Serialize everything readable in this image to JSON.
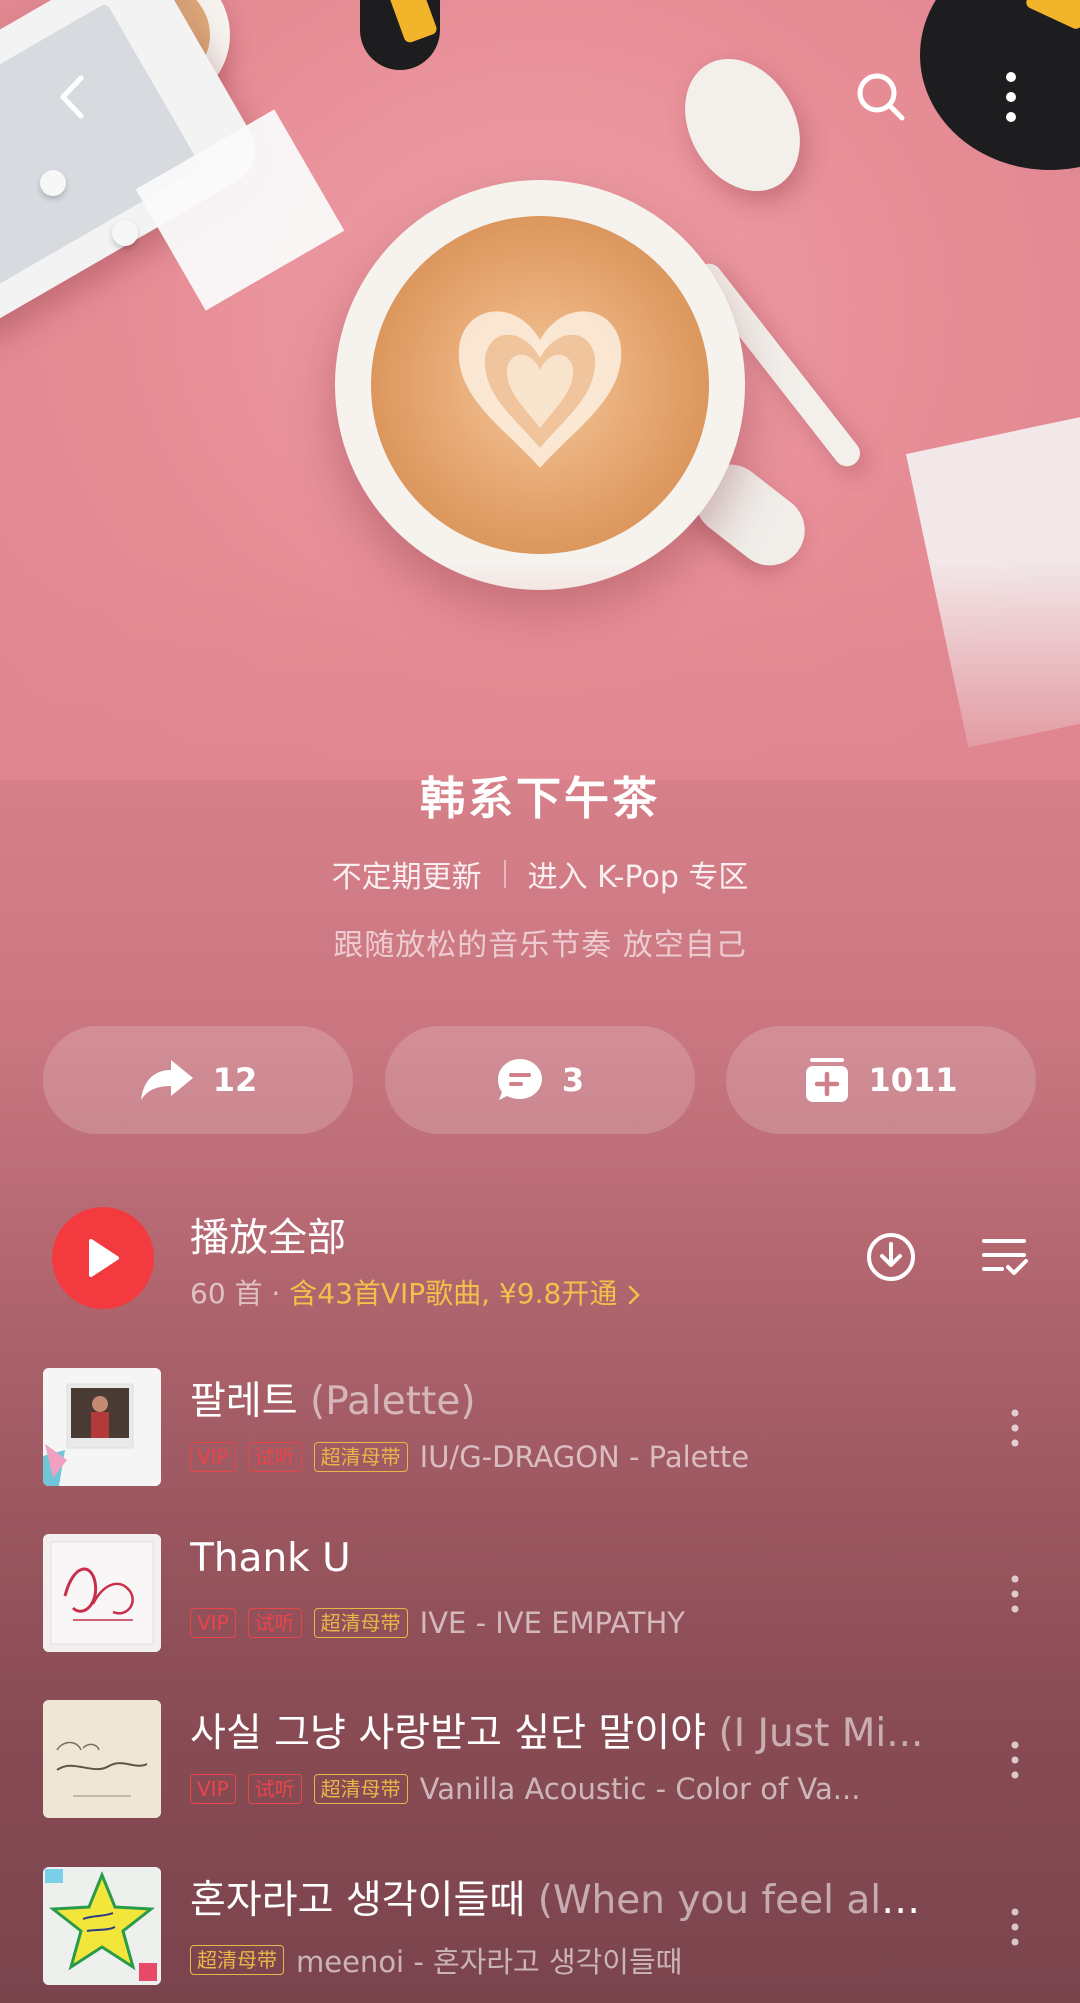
{
  "header": {
    "back_icon": "chevron-left-icon",
    "search_icon": "search-icon",
    "more_icon": "more-vertical-icon"
  },
  "playlist": {
    "title": "韩系下午茶",
    "update_text": "不定期更新",
    "zone_link": "进入 K-Pop 专区",
    "description": "跟随放松的音乐节奏 放空自己"
  },
  "actions": {
    "share": {
      "icon": "share-icon",
      "count": "12"
    },
    "comment": {
      "icon": "comment-icon",
      "count": "3"
    },
    "collect": {
      "icon": "add-to-collection-icon",
      "count": "1011"
    }
  },
  "play_all": {
    "label": "播放全部",
    "count_text": "60 首 ·",
    "vip_text": "含43首VIP歌曲, ¥9.8开通",
    "download_icon": "download-icon",
    "multi_select_icon": "list-check-icon"
  },
  "colors": {
    "play_button": "#f23a3f",
    "vip_gold": "#f3c04b",
    "tag_red": "#e8454a",
    "tag_gold": "#eab54a"
  },
  "songs": [
    {
      "title": "팔레트",
      "title_paren": "(Palette)",
      "tags": [
        "VIP",
        "试听",
        "超清母带"
      ],
      "artist": "IU/G-DRAGON - Palette"
    },
    {
      "title": "Thank U",
      "title_paren": "",
      "tags": [
        "VIP",
        "试听",
        "超清母带"
      ],
      "artist": "IVE - IVE EMPATHY"
    },
    {
      "title": "사실 그냥 사랑받고 싶단 말이야",
      "title_paren": "(I Just Mi...",
      "tags": [
        "VIP",
        "试听",
        "超清母带"
      ],
      "artist": "Vanilla Acoustic - Color of Va..."
    },
    {
      "title": "혼자라고 생각이들때",
      "title_paren": "(When you feel alo...",
      "tags": [
        "超清母带"
      ],
      "artist": "meenoi - 혼자라고 생각이들때"
    }
  ]
}
